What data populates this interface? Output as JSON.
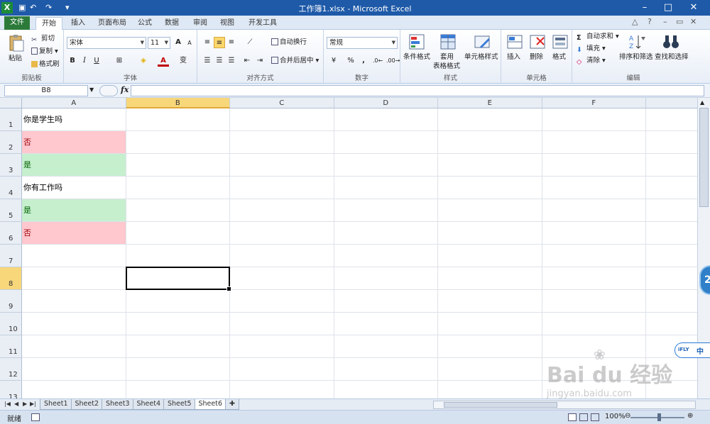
{
  "window": {
    "title": "工作簿1.xlsx - Microsoft Excel",
    "app_icon_letter": "X"
  },
  "ribbon_tabs": [
    "文件",
    "开始",
    "插入",
    "页面布局",
    "公式",
    "数据",
    "审阅",
    "视图",
    "开发工具"
  ],
  "active_tab": "开始",
  "clipboard": {
    "paste": "粘贴",
    "cut": "剪切",
    "copy": "复制",
    "format_painter": "格式刷",
    "label": "剪贴板"
  },
  "font": {
    "name": "宋体",
    "size": "11",
    "label": "字体",
    "bold": "B",
    "italic": "I",
    "underline": "U",
    "grow": "A",
    "shrink": "A",
    "font_color_letter": "A",
    "phonetic": "变"
  },
  "alignment": {
    "wrap_text": "自动换行",
    "merge_center": "合并后居中",
    "label": "对齐方式"
  },
  "number": {
    "format": "常规",
    "percent": "%",
    "comma": ",",
    "label": "数字"
  },
  "styles": {
    "conditional": "条件格式",
    "table_line1": "套用",
    "table_line2": "表格格式",
    "cell_styles": "单元格样式",
    "label": "样式"
  },
  "cells_group": {
    "insert": "插入",
    "delete": "删除",
    "format": "格式",
    "label": "单元格"
  },
  "editing": {
    "autosum": "自动求和",
    "fill": "填充",
    "clear": "清除",
    "sort_filter": "排序和筛选",
    "find_select": "查找和选择",
    "label": "编辑"
  },
  "formula_bar": {
    "name_box": "B8",
    "fx": "fx",
    "content": ""
  },
  "columns": [
    "A",
    "B",
    "C",
    "D",
    "E",
    "F"
  ],
  "rows": [
    "1",
    "2",
    "3",
    "4",
    "5",
    "6",
    "7",
    "8",
    "9",
    "10",
    "11",
    "12",
    "13"
  ],
  "selected_cell": "B8",
  "cells": [
    {
      "ref": "A1",
      "text": "你是学生吗",
      "fill": "#ffffff",
      "color": "#000000"
    },
    {
      "ref": "A2",
      "text": "否",
      "fill": "#ffc7ce",
      "color": "#9c0006"
    },
    {
      "ref": "A3",
      "text": "是",
      "fill": "#c6efce",
      "color": "#006100"
    },
    {
      "ref": "A4",
      "text": "你有工作吗",
      "fill": "#ffffff",
      "color": "#000000"
    },
    {
      "ref": "A5",
      "text": "是",
      "fill": "#c6efce",
      "color": "#006100"
    },
    {
      "ref": "A6",
      "text": "否",
      "fill": "#ffc7ce",
      "color": "#9c0006"
    }
  ],
  "sheets": [
    "Sheet1",
    "Sheet2",
    "Sheet3",
    "Sheet4",
    "Sheet5",
    "Sheet6"
  ],
  "active_sheet": "Sheet6",
  "status": {
    "ready": "就绪",
    "zoom": "100%"
  },
  "ime": {
    "brand": "iFLY",
    "mode": "中"
  },
  "watermark": {
    "main": "Bai du 经验",
    "sub": "jingyan.baidu.com"
  },
  "colors": {
    "titlebar": "#1e5aa8",
    "file_tab": "#2c7a3a",
    "bad_fill": "#ffc7ce",
    "bad_text": "#9c0006",
    "good_fill": "#c6efce",
    "good_text": "#006100",
    "header_selected": "#f7d77a"
  }
}
